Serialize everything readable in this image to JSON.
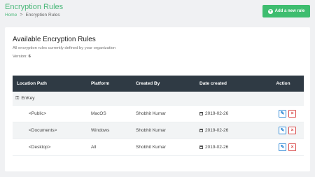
{
  "header": {
    "title": "Encryption Rules",
    "breadcrumb": {
      "home": "Home",
      "separator": ">",
      "current": "Encryption Rules"
    },
    "add_button_label": "Add a new rule"
  },
  "card": {
    "title": "Available Encryption Rules",
    "subtitle": "All encryption rules currently defined by your organization",
    "version_label": "Version:",
    "version_value": "6"
  },
  "table": {
    "columns": [
      "Location Path",
      "Platform",
      "Created By",
      "Date created",
      "Action"
    ],
    "group": {
      "label": "EnKey"
    },
    "rows": [
      {
        "path": "<Public>",
        "platform": "MacOS",
        "created_by": "Shobhit Kumar",
        "date": "2019-02-26"
      },
      {
        "path": "<Documents>",
        "platform": "Windows",
        "created_by": "Shobhit Kumar",
        "date": "2019-02-26"
      },
      {
        "path": "<Desktop>",
        "platform": "All",
        "created_by": "Shobhit Kumar",
        "date": "2019-02-26"
      }
    ]
  },
  "colors": {
    "accent": "#3ebd6f",
    "table_header": "#2f3a44",
    "edit": "#3a8fd8",
    "delete": "#d84a4a"
  },
  "icons": {
    "add": "plus-circle-icon",
    "group": "key-icon",
    "date": "calendar-icon",
    "edit": "pencil-icon",
    "delete": "close-icon"
  }
}
